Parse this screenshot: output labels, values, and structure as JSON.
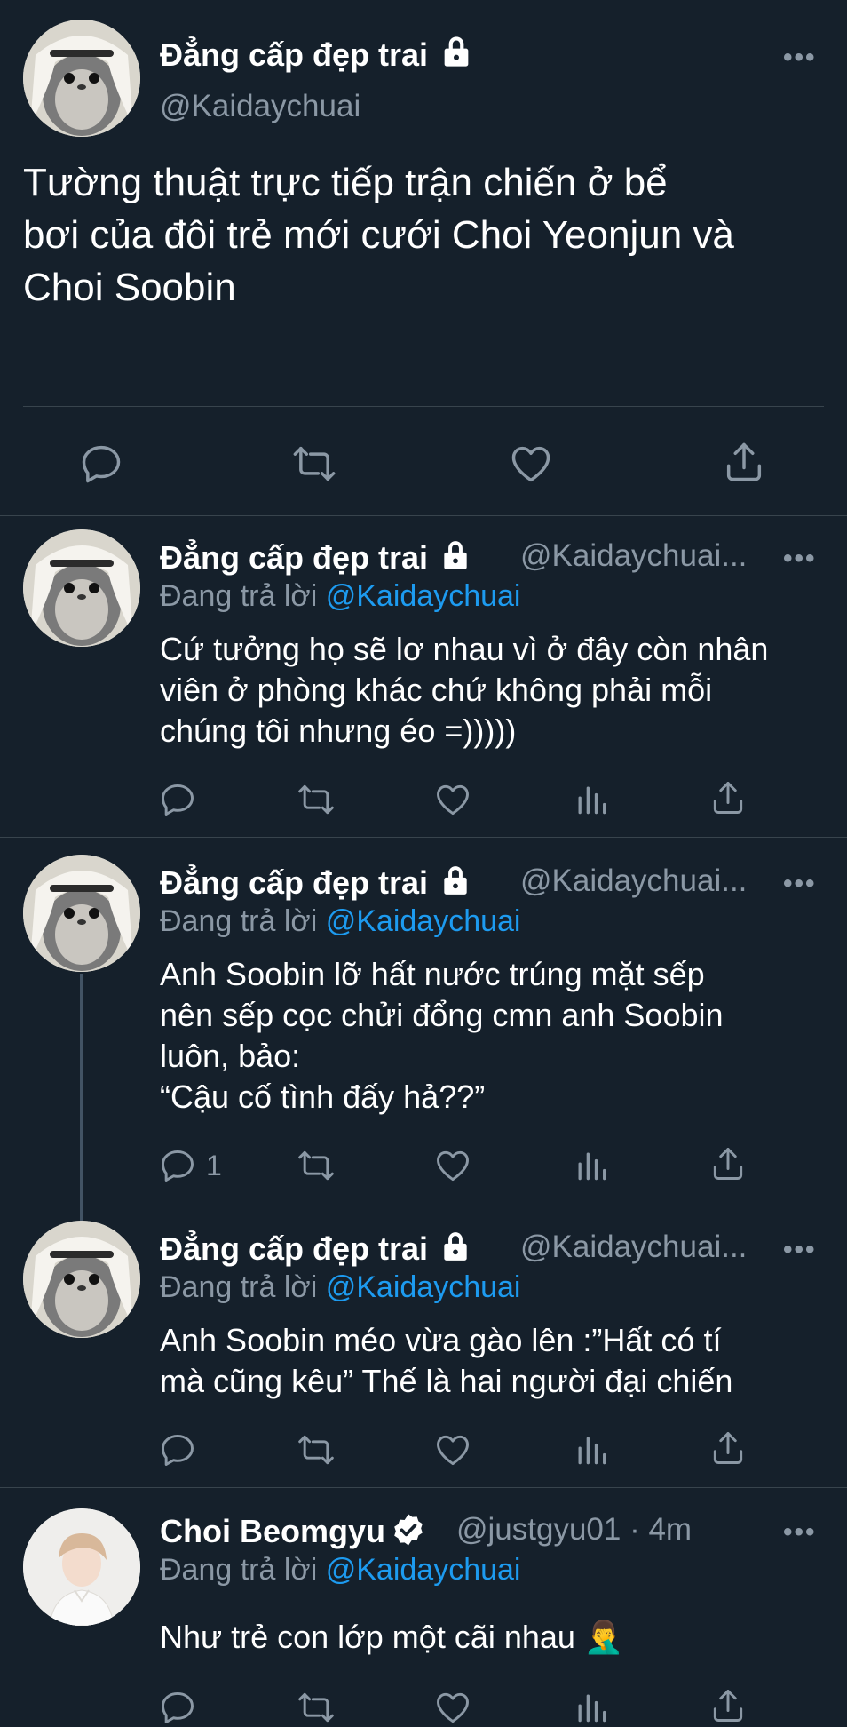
{
  "main_tweet": {
    "name": "Đẳng cấp đẹp trai",
    "handle": "@Kaidaychuai",
    "text_lines": [
      "Tường thuật trực tiếp trận chiến ở bể",
      "bơi của đôi trẻ mới cưới Choi Yeonjun và",
      "Choi Soobin"
    ],
    "more": "•••"
  },
  "replies": [
    {
      "name": "Đẳng cấp đẹp trai",
      "handle": "@Kaidaychuai...",
      "replying_prefix": "Đang trả lời",
      "replying_to": "@Kaidaychuai",
      "text_lines": [
        "Cứ tưởng họ sẽ lơ nhau vì ở đây còn nhân",
        "viên ở phòng khác chứ không phải mỗi",
        "chúng tôi nhưng éo =)))))"
      ],
      "reply_count": "",
      "more": "•••"
    },
    {
      "name": "Đẳng cấp đẹp trai",
      "handle": "@Kaidaychuai...",
      "replying_prefix": "Đang trả lời",
      "replying_to": "@Kaidaychuai",
      "text_lines": [
        "Anh Soobin lỡ hất nước trúng mặt sếp",
        "nên sếp cọc chửi đổng cmn anh Soobin",
        "luôn, bảo:",
        "“Cậu cố tình đấy hả??”"
      ],
      "reply_count": "1",
      "more": "•••"
    },
    {
      "name": "Đẳng cấp đẹp trai",
      "handle": "@Kaidaychuai...",
      "replying_prefix": "Đang trả lời",
      "replying_to": "@Kaidaychuai",
      "text_lines": [
        "Anh Soobin méo vừa gào lên :”Hất có tí",
        "mà cũng kêu” Thế là hai người đại chiến"
      ],
      "reply_count": "",
      "more": "•••"
    },
    {
      "name": "Choi Beomgyu",
      "handle": "@justgyu01 · 4m",
      "replying_prefix": "Đang trả lời",
      "replying_to": "@Kaidaychuai",
      "text_lines": [
        "Như trẻ con lớp một cãi nhau 🤦‍♂️"
      ],
      "reply_count": "",
      "more": "•••"
    }
  ],
  "icons": {
    "reply": "reply-icon",
    "retweet": "retweet-icon",
    "like": "heart-icon",
    "analytics": "analytics-icon",
    "share": "share-icon",
    "lock": "lock-icon",
    "verified": "verified-badge-icon"
  },
  "colors": {
    "background": "#15202b",
    "text": "#ffffff",
    "secondary": "#8b98a5",
    "link": "#1d9bf0",
    "divider": "#38444d"
  }
}
